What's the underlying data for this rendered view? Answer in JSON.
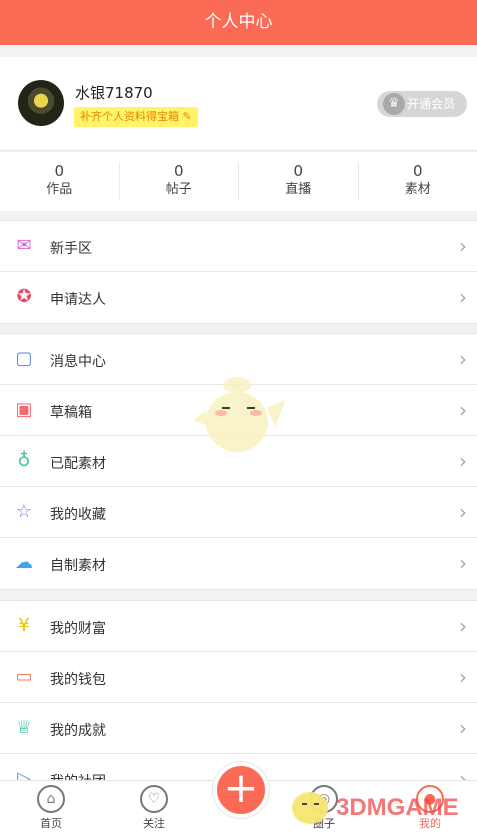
{
  "header": {
    "title": "个人中心"
  },
  "profile": {
    "username": "水银71870",
    "promo_text": "补齐个人资料得宝箱 ✎",
    "vip_label": "开通会员",
    "vip_icon": "crown-icon"
  },
  "stats": [
    {
      "count": "0",
      "label": "作品"
    },
    {
      "count": "0",
      "label": "帖子"
    },
    {
      "count": "0",
      "label": "直播"
    },
    {
      "count": "0",
      "label": "素材"
    }
  ],
  "groups": [
    [
      {
        "label": "新手区",
        "icon": "gift-icon",
        "color": "#e05fd0"
      },
      {
        "label": "申请达人",
        "icon": "star-badge-icon",
        "color": "#f04763"
      }
    ],
    [
      {
        "label": "消息中心",
        "icon": "message-icon",
        "color": "#5a89e6"
      },
      {
        "label": "草稿箱",
        "icon": "inbox-icon",
        "color": "#f26a75"
      },
      {
        "label": "已配素材",
        "icon": "microphone-icon",
        "color": "#35c6a5"
      },
      {
        "label": "我的收藏",
        "icon": "bookmark-star-icon",
        "color": "#a56ad9"
      },
      {
        "label": "自制素材",
        "icon": "cloud-upload-icon",
        "color": "#3fa4e8"
      }
    ],
    [
      {
        "label": "我的财富",
        "icon": "coin-icon",
        "color": "#f1c000"
      },
      {
        "label": "我的钱包",
        "icon": "wallet-icon",
        "color": "#ef7b5b"
      },
      {
        "label": "我的成就",
        "icon": "trophy-icon",
        "color": "#2fbe9d"
      },
      {
        "label": "我的社团",
        "icon": "play-icon",
        "color": "#3fa4e8"
      }
    ]
  ],
  "bottom_nav": [
    {
      "label": "首页",
      "icon": "home-icon"
    },
    {
      "label": "关注",
      "icon": "heart-icon"
    },
    {
      "label": "圈子",
      "icon": "circle-icon"
    },
    {
      "label": "我的",
      "icon": "person-icon"
    }
  ],
  "watermark": "3DMGAME",
  "colors": {
    "accent": "#fb6a54",
    "promo_bg": "#fff36a",
    "promo_text": "#e08a00"
  }
}
